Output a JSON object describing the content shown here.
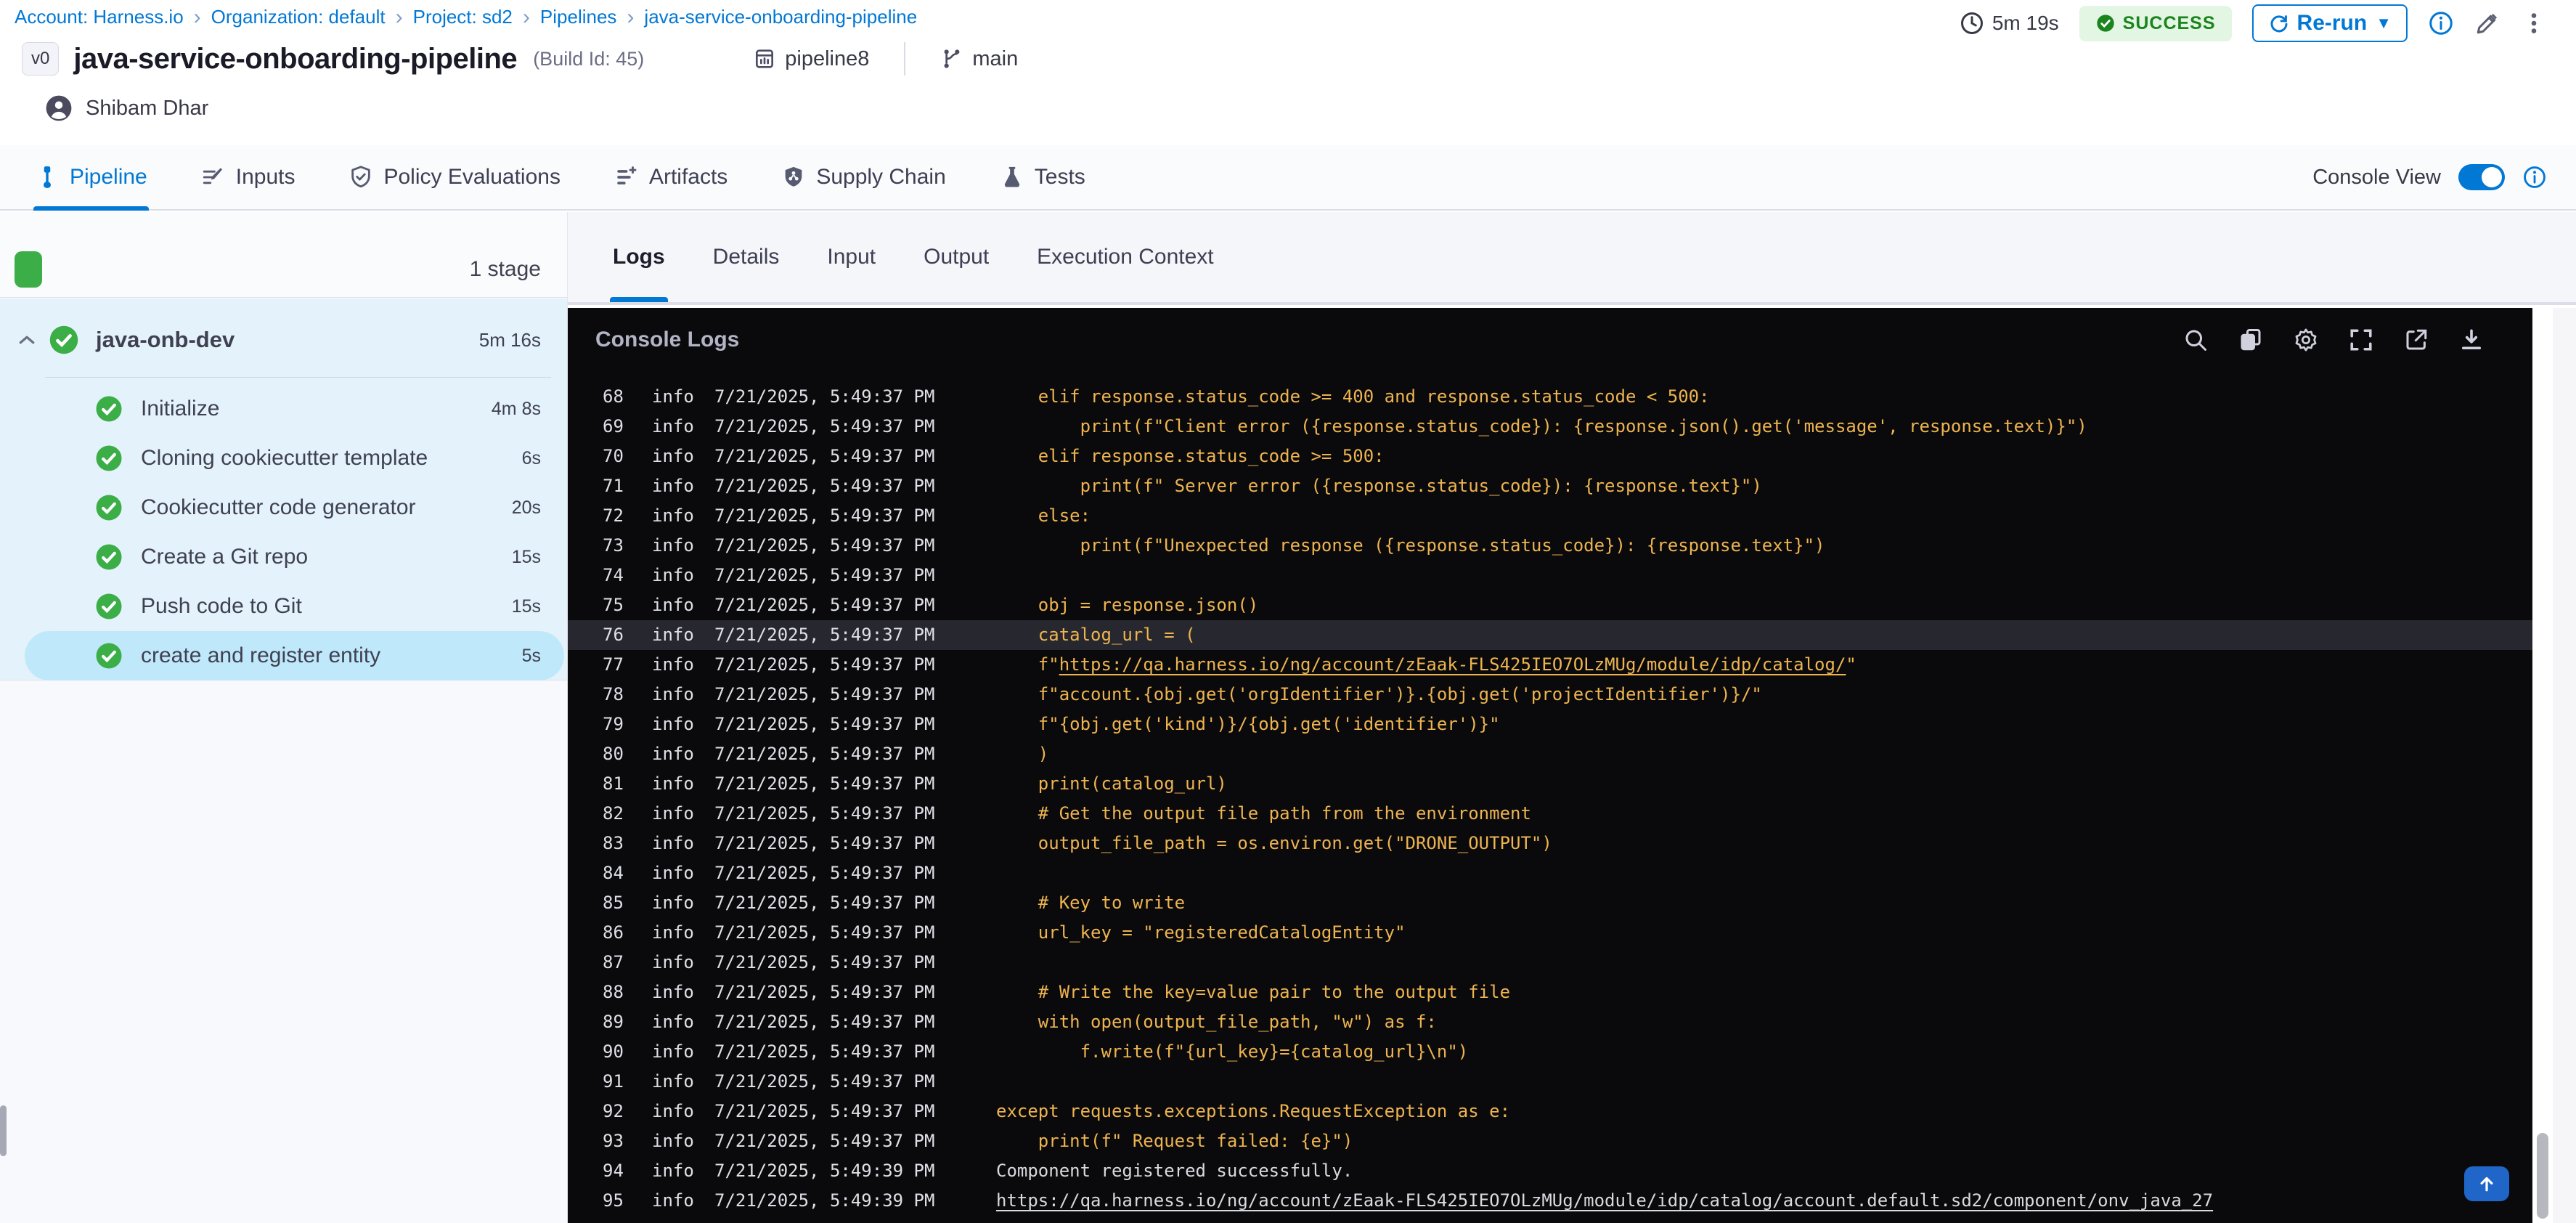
{
  "colors": {
    "accent": "#0278d5",
    "success": "#1b841d",
    "success_bg": "#e3f6e4",
    "green": "#3cae47",
    "tree_bg": "#e4f2fb",
    "selected_step_bg": "#bfe9fa",
    "console_bg": "#0a0a0d",
    "code_text": "#eeb44f",
    "highlight_row": "#27272f",
    "scrolltop": "#2066c8"
  },
  "breadcrumb": {
    "items": [
      "Account: Harness.io",
      "Organization: default",
      "Project: sd2",
      "Pipelines",
      "java-service-onboarding-pipeline"
    ]
  },
  "header": {
    "version_badge": "v0",
    "title": "java-service-onboarding-pipeline",
    "build_id": "(Build Id: 45)",
    "template": "pipeline8",
    "branch": "main",
    "creator": "Shibam Dhar",
    "duration": "5m 19s",
    "status": "SUCCESS",
    "rerun_label": "Re-run"
  },
  "tabs": {
    "items": [
      {
        "label": "Pipeline",
        "icon": "pipeline",
        "active": true
      },
      {
        "label": "Inputs",
        "icon": "inputs",
        "active": false
      },
      {
        "label": "Policy Evaluations",
        "icon": "policy",
        "active": false
      },
      {
        "label": "Artifacts",
        "icon": "artifacts",
        "active": false
      },
      {
        "label": "Supply Chain",
        "icon": "supplychain",
        "active": false
      },
      {
        "label": "Tests",
        "icon": "tests",
        "active": false
      }
    ],
    "console_view_label": "Console View",
    "console_view_on": true
  },
  "sidebar": {
    "stage_count_label": "1 stage",
    "stage": {
      "name": "java-onb-dev",
      "duration": "5m 16s"
    },
    "steps": [
      {
        "name": "Initialize",
        "duration": "4m 8s",
        "selected": false
      },
      {
        "name": "Cloning cookiecutter template",
        "duration": "6s",
        "selected": false
      },
      {
        "name": "Cookiecutter code generator",
        "duration": "20s",
        "selected": false
      },
      {
        "name": "Create a Git repo",
        "duration": "15s",
        "selected": false
      },
      {
        "name": "Push code to Git",
        "duration": "15s",
        "selected": false
      },
      {
        "name": "create and register entity",
        "duration": "5s",
        "selected": true
      }
    ]
  },
  "detail_tabs": {
    "items": [
      "Logs",
      "Details",
      "Input",
      "Output",
      "Execution Context"
    ],
    "active": "Logs"
  },
  "console": {
    "title": "Console Logs",
    "toolbar_icons": [
      "search",
      "copy",
      "settings",
      "fullscreen",
      "open-in-new",
      "download"
    ],
    "lines": [
      {
        "n": "68",
        "lvl": "info",
        "ts": "7/21/2025, 5:49:37 PM",
        "kind": "code",
        "pre": "    elif response.status_code >= 400 and response.status_code < 500:"
      },
      {
        "n": "69",
        "lvl": "info",
        "ts": "7/21/2025, 5:49:37 PM",
        "kind": "code",
        "pre": "        print(f\"Client error ({response.status_code}): {response.json().get('message', response.text)}\")"
      },
      {
        "n": "70",
        "lvl": "info",
        "ts": "7/21/2025, 5:49:37 PM",
        "kind": "code",
        "pre": "    elif response.status_code >= 500:"
      },
      {
        "n": "71",
        "lvl": "info",
        "ts": "7/21/2025, 5:49:37 PM",
        "kind": "code",
        "pre": "        print(f\" Server error ({response.status_code}): {response.text}\")"
      },
      {
        "n": "72",
        "lvl": "info",
        "ts": "7/21/2025, 5:49:37 PM",
        "kind": "code",
        "pre": "    else:"
      },
      {
        "n": "73",
        "lvl": "info",
        "ts": "7/21/2025, 5:49:37 PM",
        "kind": "code",
        "pre": "        print(f\"Unexpected response ({response.status_code}): {response.text}\")"
      },
      {
        "n": "74",
        "lvl": "info",
        "ts": "7/21/2025, 5:49:37 PM",
        "kind": "code",
        "pre": ""
      },
      {
        "n": "75",
        "lvl": "info",
        "ts": "7/21/2025, 5:49:37 PM",
        "kind": "code",
        "pre": "    obj = response.json()"
      },
      {
        "n": "76",
        "lvl": "info",
        "ts": "7/21/2025, 5:49:37 PM",
        "kind": "code",
        "pre": "    catalog_url = (",
        "highlight": true
      },
      {
        "n": "77",
        "lvl": "info",
        "ts": "7/21/2025, 5:49:37 PM",
        "kind": "code",
        "pre": "    f\"",
        "link": "https://qa.harness.io/ng/account/zEaak-FLS425IEO7OLzMUg/module/idp/catalog/",
        "post": "\""
      },
      {
        "n": "78",
        "lvl": "info",
        "ts": "7/21/2025, 5:49:37 PM",
        "kind": "code",
        "pre": "    f\"account.{obj.get('orgIdentifier')}.{obj.get('projectIdentifier')}/\""
      },
      {
        "n": "79",
        "lvl": "info",
        "ts": "7/21/2025, 5:49:37 PM",
        "kind": "code",
        "pre": "    f\"{obj.get('kind')}/{obj.get('identifier')}\""
      },
      {
        "n": "80",
        "lvl": "info",
        "ts": "7/21/2025, 5:49:37 PM",
        "kind": "code",
        "pre": "    )"
      },
      {
        "n": "81",
        "lvl": "info",
        "ts": "7/21/2025, 5:49:37 PM",
        "kind": "code",
        "pre": "    print(catalog_url)"
      },
      {
        "n": "82",
        "lvl": "info",
        "ts": "7/21/2025, 5:49:37 PM",
        "kind": "code",
        "pre": "    # Get the output file path from the environment"
      },
      {
        "n": "83",
        "lvl": "info",
        "ts": "7/21/2025, 5:49:37 PM",
        "kind": "code",
        "pre": "    output_file_path = os.environ.get(\"DRONE_OUTPUT\")"
      },
      {
        "n": "84",
        "lvl": "info",
        "ts": "7/21/2025, 5:49:37 PM",
        "kind": "code",
        "pre": ""
      },
      {
        "n": "85",
        "lvl": "info",
        "ts": "7/21/2025, 5:49:37 PM",
        "kind": "code",
        "pre": "    # Key to write"
      },
      {
        "n": "86",
        "lvl": "info",
        "ts": "7/21/2025, 5:49:37 PM",
        "kind": "code",
        "pre": "    url_key = \"registeredCatalogEntity\""
      },
      {
        "n": "87",
        "lvl": "info",
        "ts": "7/21/2025, 5:49:37 PM",
        "kind": "code",
        "pre": ""
      },
      {
        "n": "88",
        "lvl": "info",
        "ts": "7/21/2025, 5:49:37 PM",
        "kind": "code",
        "pre": "    # Write the key=value pair to the output file"
      },
      {
        "n": "89",
        "lvl": "info",
        "ts": "7/21/2025, 5:49:37 PM",
        "kind": "code",
        "pre": "    with open(output_file_path, \"w\") as f:"
      },
      {
        "n": "90",
        "lvl": "info",
        "ts": "7/21/2025, 5:49:37 PM",
        "kind": "code",
        "pre": "        f.write(f\"{url_key}={catalog_url}\\n\")"
      },
      {
        "n": "91",
        "lvl": "info",
        "ts": "7/21/2025, 5:49:37 PM",
        "kind": "code",
        "pre": ""
      },
      {
        "n": "92",
        "lvl": "info",
        "ts": "7/21/2025, 5:49:37 PM",
        "kind": "code",
        "pre": "except requests.exceptions.RequestException as e:"
      },
      {
        "n": "93",
        "lvl": "info",
        "ts": "7/21/2025, 5:49:37 PM",
        "kind": "code",
        "pre": "    print(f\" Request failed: {e}\")"
      },
      {
        "n": "94",
        "lvl": "info",
        "ts": "7/21/2025, 5:49:39 PM",
        "kind": "out",
        "pre": "Component registered successfully."
      },
      {
        "n": "95",
        "lvl": "info",
        "ts": "7/21/2025, 5:49:39 PM",
        "kind": "out",
        "pre": "",
        "link": "https://qa.harness.io/ng/account/zEaak-FLS425IEO7OLzMUg/module/idp/catalog/account.default.sd2/component/onv_java_27"
      }
    ]
  }
}
